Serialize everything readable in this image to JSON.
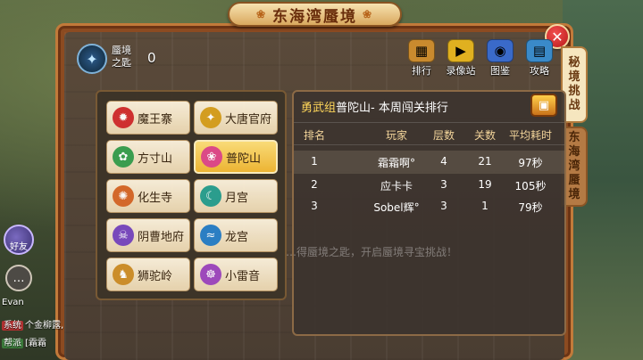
{
  "title": "东海湾蜃境",
  "key": {
    "label_line1": "蜃境",
    "label_line2": "之匙",
    "count": "0"
  },
  "actions": [
    {
      "label": "排行",
      "icon": "ranking-icon",
      "color": "#c98a2e"
    },
    {
      "label": "录像站",
      "icon": "video-camera-icon",
      "color": "#e0b020"
    },
    {
      "label": "图鉴",
      "icon": "book-icon",
      "color": "#3a6ac9"
    },
    {
      "label": "攻略",
      "icon": "guide-book-icon",
      "color": "#3a8ac9"
    }
  ],
  "side_tabs": [
    {
      "label": "秘境挑战",
      "chars": [
        "秘",
        "境",
        "挑",
        "战"
      ],
      "active": true
    },
    {
      "label": "东海湾蜃境",
      "chars": [
        "东",
        "海",
        "湾",
        "蜃",
        "境"
      ],
      "active": false
    }
  ],
  "sects": [
    {
      "name": "魔王寨",
      "icon": "demon-fort-icon",
      "color": "#d23030"
    },
    {
      "name": "大唐官府",
      "icon": "tang-palace-icon",
      "color": "#d8a020"
    },
    {
      "name": "方寸山",
      "icon": "fangcun-mountain-icon",
      "color": "#3aa050"
    },
    {
      "name": "普陀山",
      "icon": "lotus-icon",
      "color": "#e04a8a",
      "selected": true
    },
    {
      "name": "化生寺",
      "icon": "huasheng-temple-icon",
      "color": "#d86a2a"
    },
    {
      "name": "月宫",
      "icon": "moon-palace-icon",
      "color": "#2aa090"
    },
    {
      "name": "阴曹地府",
      "icon": "underworld-icon",
      "color": "#7a4ac0"
    },
    {
      "name": "龙宫",
      "icon": "dragon-palace-icon",
      "color": "#2a80c8"
    },
    {
      "name": "狮驼岭",
      "icon": "lion-ridge-icon",
      "color": "#d0902a"
    },
    {
      "name": "小雷音",
      "icon": "xiaoleiyin-icon",
      "color": "#a04ac0"
    }
  ],
  "ranking": {
    "header_group": "勇武组",
    "header_sect": "普陀山",
    "header_rest": " - 本周闯关排行",
    "columns": [
      "排名",
      "玩家",
      "层数",
      "关数",
      "平均耗时"
    ],
    "rows": [
      {
        "rank": "1",
        "player": "霜霜啊°",
        "floor": "4",
        "levels": "21",
        "time": "97秒"
      },
      {
        "rank": "2",
        "player": "应卡卡",
        "floor": "3",
        "levels": "19",
        "time": "105秒"
      },
      {
        "rank": "3",
        "player": "Sobel辉°",
        "floor": "3",
        "levels": "1",
        "time": "79秒"
      }
    ]
  },
  "hint": "…得蜃境之匙，开启蜃境寻宝挑战！",
  "hud": {
    "friend_label": "好友",
    "chat_lines": [
      {
        "tag": "",
        "text": "Evan"
      },
      {
        "tag": "系统",
        "text": "个金柳露,"
      },
      {
        "tag": "帮派",
        "text": "[霜霜"
      }
    ]
  }
}
